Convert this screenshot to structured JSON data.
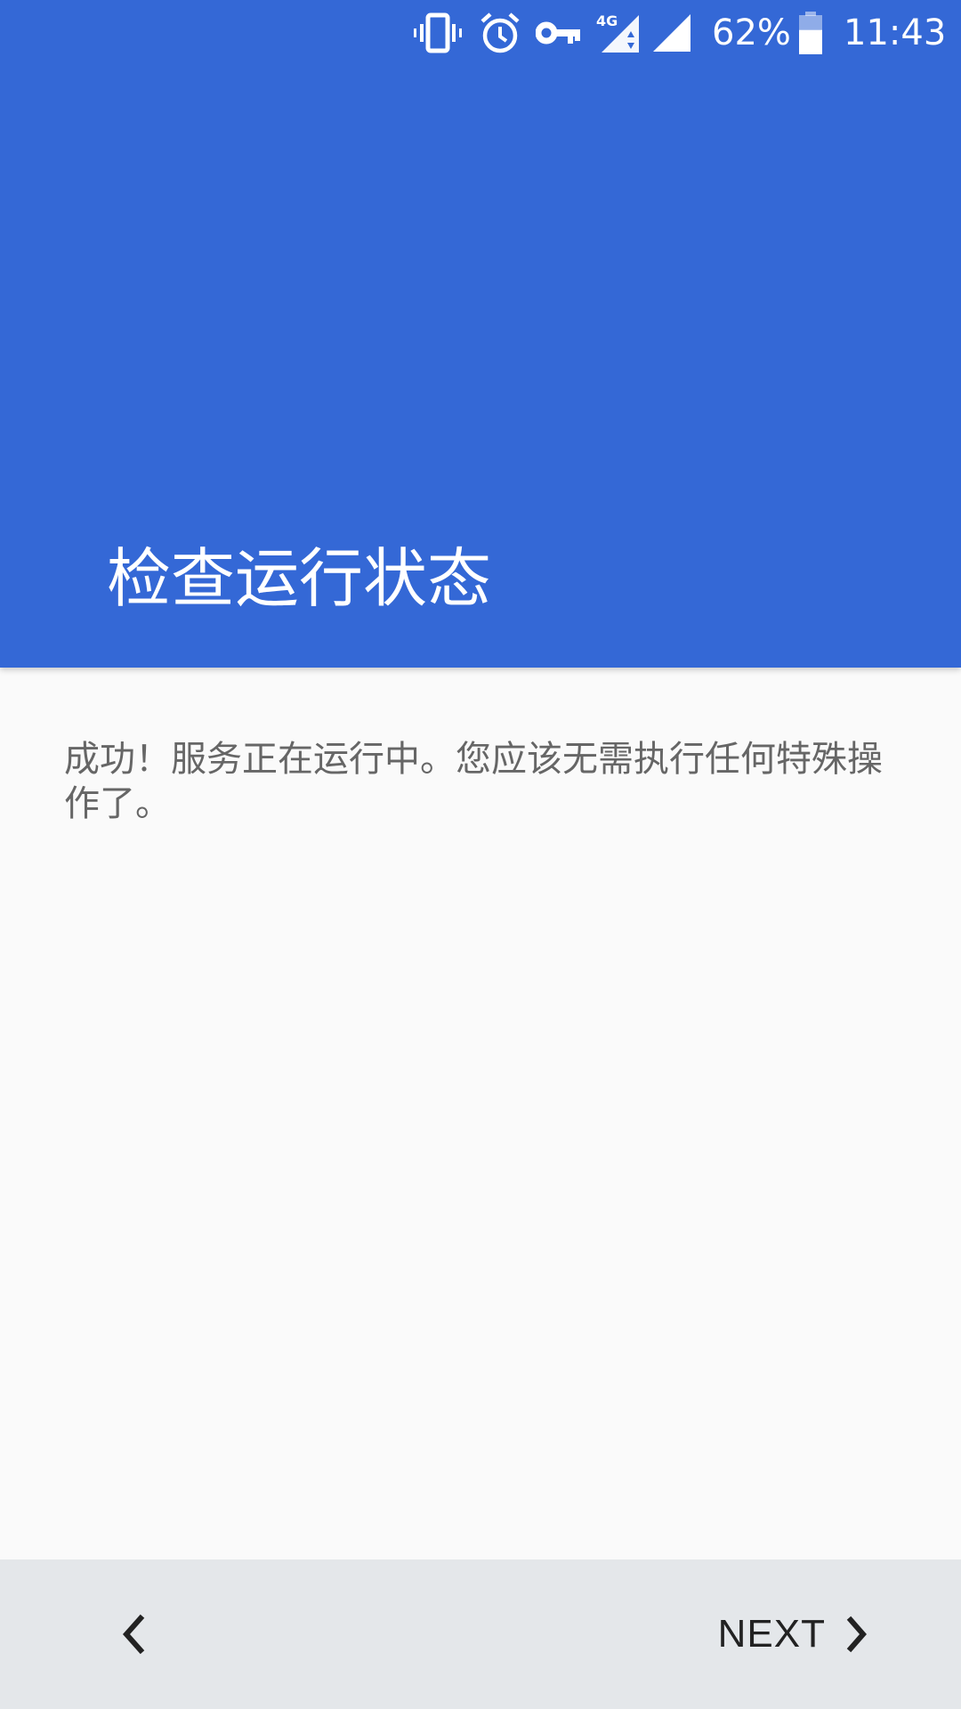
{
  "status_bar": {
    "battery_percent": "62%",
    "time": "11:43",
    "network_label": "4G",
    "icons": [
      "vibrate-icon",
      "alarm-icon",
      "vpn-key-icon",
      "mobile-data-4g-icon",
      "signal-icon",
      "battery-icon"
    ],
    "battery_level": 0.62
  },
  "header": {
    "title": "检查运行状态"
  },
  "main": {
    "message": "成功！服务正在运行中。您应该无需执行任何特殊操作了。"
  },
  "nav": {
    "back_icon": "chevron-left-icon",
    "next_label": "NEXT",
    "next_icon": "chevron-right-icon"
  },
  "colors": {
    "header_bg": "#3468d6",
    "page_bg": "#fafafa",
    "nav_bg": "#e4e7ea",
    "body_text": "#666666"
  }
}
